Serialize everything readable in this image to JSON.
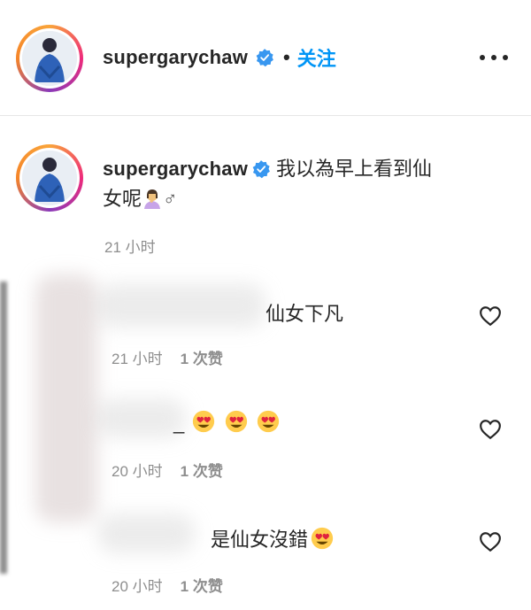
{
  "header": {
    "username": "supergarychaw",
    "separator": "•",
    "follow_label": "关注"
  },
  "post": {
    "username": "supergarychaw",
    "caption_line1": "我以為早上看到仙",
    "caption_line2": "女呢",
    "caption_suffix": "♂",
    "time": "21 小时"
  },
  "comments": [
    {
      "text": "仙女下凡",
      "time": "21 小时",
      "likes": "1 次赞"
    },
    {
      "text": "_",
      "time": "20 小时",
      "likes": "1 次赞"
    },
    {
      "text": "是仙女沒錯",
      "time": "20 小时",
      "likes": "1 次赞"
    }
  ],
  "colors": {
    "follow_blue": "#0095f6",
    "verified_blue": "#3897f0",
    "secondary_gray": "#8e8e8e"
  },
  "icons": [
    "verified-badge-icon",
    "more-options-icon",
    "heart-icon",
    "heart-eyes-emoji",
    "woman-facepalming-emoji"
  ]
}
